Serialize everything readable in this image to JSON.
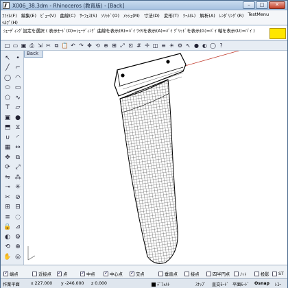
{
  "window": {
    "title": "X006_38.3dm - Rhinoceros (教育版) - [Back]",
    "minimize_label": "–",
    "maximize_label": "□",
    "close_label": "✕"
  },
  "menu": {
    "row1": [
      "ﾌｧｲﾙ(F)",
      "編集(E)",
      "ﾋﾞｭｰ(V)",
      "曲線(C)",
      "ｻｰﾌｪｽ(S)",
      "ｿﾘｯﾄﾞ(O)",
      "ﾒｯｼｭ(M)",
      "寸法(D)",
      "変形(T)",
      "ﾂｰﾙ(L)",
      "解析(A)",
      "ﾚﾝﾀﾞﾘﾝｸﾞ(R)",
      "TestMenu"
    ],
    "row2": [
      "ﾍﾙﾌﾟ(H)"
    ]
  },
  "command": {
    "line": "ｼｪｰﾃﾞｨﾝｸﾞ設定を選択 ( 表示ﾓｰﾄﾞ(D)=ｼｪｰﾃﾞｨﾝｸﾞ 曲線を表示(B)=ﾊﾞｲ ﾜｲﾔを表示(A)=ﾊﾞｲ ｸﾞﾘｯﾄﾞを表示(G)=ﾊﾞｲ 軸を表示(U)=ﾊﾞｲ )",
    "accent_color": "#ffe600"
  },
  "toolbar_icons": [
    "new-icon",
    "open-icon",
    "save-icon",
    "print-icon",
    "import-icon",
    "cut-icon",
    "copy-icon",
    "paste-icon",
    "undo-icon",
    "redo-icon",
    "pan-icon",
    "rotate-view-icon",
    "zoom-icon",
    "zoom-window-icon",
    "zoom-extents-icon",
    "zoom-selected-icon",
    "grid-icon",
    "move-icon",
    "wireframe-icon",
    "layer-icon",
    "light-icon",
    "properties-icon",
    "select-icon",
    "render-icon",
    "material-icon",
    "sphere-icon",
    "help-icon"
  ],
  "viewport": {
    "label": "Back"
  },
  "osnap": {
    "items": [
      {
        "label": "端点",
        "checked": true
      },
      {
        "label": "近接点",
        "checked": false
      },
      {
        "label": "点",
        "checked": true
      },
      {
        "label": "中点",
        "checked": true
      },
      {
        "label": "中心点",
        "checked": true
      },
      {
        "label": "交点",
        "checked": true
      },
      {
        "label": "垂直点",
        "checked": false
      },
      {
        "label": "接点",
        "checked": false
      },
      {
        "label": "四半円点",
        "checked": false
      },
      {
        "label": "ﾉｯﾄ",
        "checked": false
      },
      {
        "label": "投影",
        "checked": false
      },
      {
        "label": "ST",
        "checked": false
      }
    ]
  },
  "status": {
    "cplane": "作業平面",
    "x": "x 227.000",
    "y": "y -246.000",
    "z": "z 0.000",
    "layer": "ﾃﾞﾌｫﾙﾄ",
    "snap": "ｽﾅｯﾌﾟ",
    "ortho": "直交ﾓｰﾄﾞ",
    "planar": "平面ﾓｰﾄﾞ",
    "osnap": "Osnap",
    "record": "ﾚｺｰ"
  }
}
